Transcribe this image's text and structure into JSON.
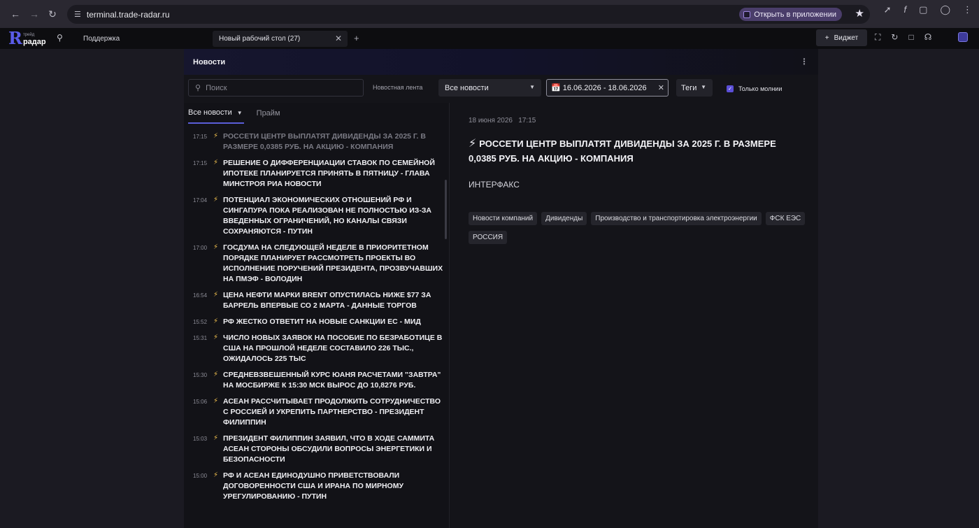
{
  "browser": {
    "url": "terminal.trade-radar.ru",
    "open_app_label": "Открыть в приложении"
  },
  "app": {
    "logo_small": "трейд",
    "logo_big": "радар",
    "support_label": "Поддержка",
    "workspace_tab": "Новый рабочий стол (27)",
    "widget_button": "Виджет"
  },
  "widget": {
    "title": "Новости",
    "search_placeholder": "Поиск",
    "feed_label": "Новостная лента",
    "feed_value": "Все новости",
    "date_range": "16.06.2026 - 18.06.2026",
    "tags_label": "Теги",
    "only_lightning_label": "Только молнии",
    "sub_tabs": [
      "Все новости",
      "Прайм"
    ]
  },
  "news": [
    {
      "time": "17:15",
      "title": "РОССЕТИ ЦЕНТР ВЫПЛАТЯТ ДИВИДЕНДЫ ЗА 2025 Г. В РАЗМЕРЕ 0,0385 РУБ. НА АКЦИЮ - КОМПАНИЯ",
      "dim": true
    },
    {
      "time": "17:15",
      "title": "РЕШЕНИЕ О ДИФФЕРЕНЦИАЦИИ СТАВОК ПО СЕМЕЙНОЙ ИПОТЕКЕ ПЛАНИРУЕТСЯ ПРИНЯТЬ В ПЯТНИЦУ - ГЛАВА МИНСТРОЯ РИА НОВОСТИ",
      "dim": false
    },
    {
      "time": "17:04",
      "title": "ПОТЕНЦИАЛ ЭКОНОМИЧЕСКИХ ОТНОШЕНИЙ РФ И СИНГАПУРА ПОКА РЕАЛИЗОВАН НЕ ПОЛНОСТЬЮ ИЗ-ЗА ВВЕДЕННЫХ ОГРАНИЧЕНИЙ, НО КАНАЛЫ СВЯЗИ СОХРАНЯЮТСЯ - ПУТИН",
      "dim": false
    },
    {
      "time": "17:00",
      "title": "ГОСДУМА НА СЛЕДУЮЩЕЙ НЕДЕЛЕ В ПРИОРИТЕТНОМ ПОРЯДКЕ ПЛАНИРУЕТ РАССМОТРЕТЬ ПРОЕКТЫ ВО ИСПОЛНЕНИЕ ПОРУЧЕНИЙ ПРЕЗИДЕНТА, ПРОЗВУЧАВШИХ НА ПМЭФ - ВОЛОДИН",
      "dim": false
    },
    {
      "time": "16:54",
      "title": "ЦЕНА НЕФТИ МАРКИ BRENT ОПУСТИЛАСЬ НИЖЕ $77 ЗА БАРРЕЛЬ ВПЕРВЫЕ СО 2 МАРТА - ДАННЫЕ ТОРГОВ",
      "dim": false
    },
    {
      "time": "15:52",
      "title": "РФ ЖЕСТКО ОТВЕТИТ НА НОВЫЕ САНКЦИИ ЕС - МИД",
      "dim": false
    },
    {
      "time": "15:31",
      "title": "ЧИСЛО НОВЫХ ЗАЯВОК НА ПОСОБИЕ ПО БЕЗРАБОТИЦЕ В США НА ПРОШЛОЙ НЕДЕЛЕ СОСТАВИЛО 226 ТЫС., ОЖИДАЛОСЬ 225 ТЫС",
      "dim": false
    },
    {
      "time": "15:30",
      "title": "СРЕДНЕВЗВЕШЕННЫЙ КУРС ЮАНЯ РАСЧЕТАМИ \"ЗАВТРА\" НА МОСБИРЖЕ К 15:30 МСК ВЫРОС ДО 10,8276 РУБ.",
      "dim": false
    },
    {
      "time": "15:06",
      "title": "АСЕАН РАССЧИТЫВАЕТ ПРОДОЛЖИТЬ СОТРУДНИЧЕСТВО С РОССИЕЙ И УКРЕПИТЬ ПАРТНЕРСТВО - ПРЕЗИДЕНТ ФИЛИППИН",
      "dim": false
    },
    {
      "time": "15:03",
      "title": "ПРЕЗИДЕНТ ФИЛИППИН ЗАЯВИЛ, ЧТО В ХОДЕ САММИТА АСЕАН СТОРОНЫ ОБСУДИЛИ ВОПРОСЫ ЭНЕРГЕТИКИ И БЕЗОПАСНОСТИ",
      "dim": false
    },
    {
      "time": "15:00",
      "title": "РФ И АСЕАН ЕДИНОДУШНО ПРИВЕТСТВОВАЛИ ДОГОВОРЕННОСТИ США И ИРАНА ПО МИРНОМУ УРЕГУЛИРОВАНИЮ - ПУТИН",
      "dim": false
    }
  ],
  "detail": {
    "date": "18 июня 2026",
    "time": "17:15",
    "title": "РОССЕТИ ЦЕНТР ВЫПЛАТЯТ ДИВИДЕНДЫ ЗА 2025 Г. В РАЗМЕРЕ 0,0385 РУБ. НА АКЦИЮ - КОМПАНИЯ",
    "source": "ИНТЕРФАКС",
    "tags": [
      "Новости компаний",
      "Дивиденды",
      "Производство и транспортировка электроэнергии",
      "ФСК ЕЭС",
      "РОССИЯ"
    ]
  },
  "colors": {
    "accent": "#5a5ed8",
    "bolt": "#f2c14e"
  }
}
